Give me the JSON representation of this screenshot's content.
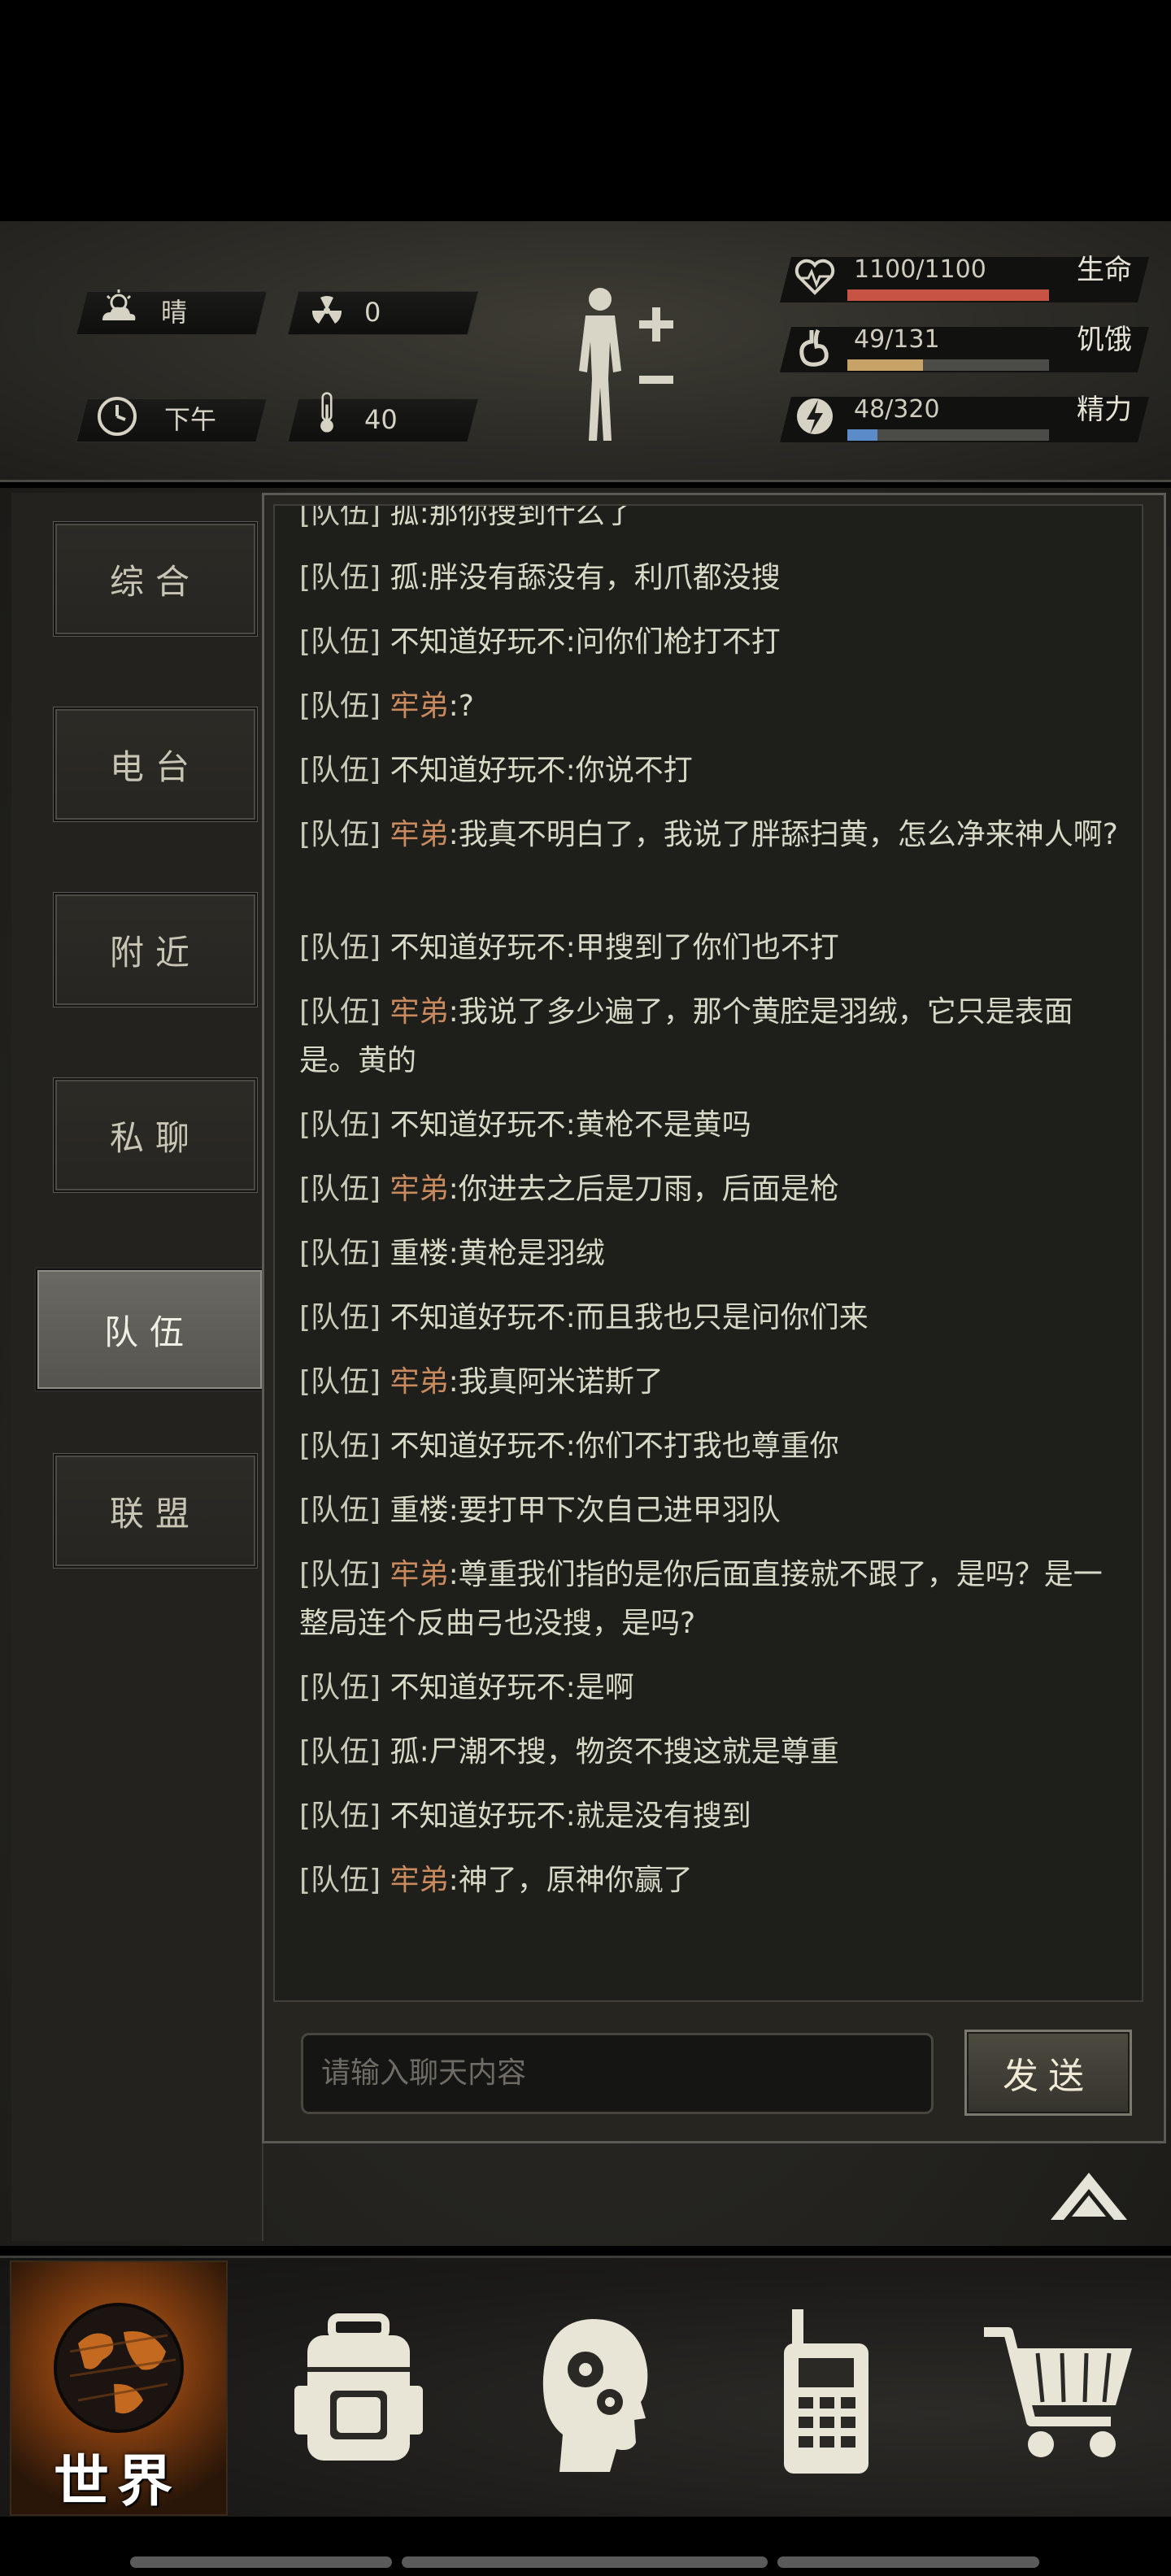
{
  "status": {
    "weather": {
      "icon": "partly-cloudy-icon",
      "label": "晴"
    },
    "radiation": {
      "icon": "radiation-icon",
      "value": "0"
    },
    "time_of_day": {
      "icon": "clock-icon",
      "label": "下午"
    },
    "temperature": {
      "icon": "thermometer-icon",
      "value": "40"
    },
    "body_status_icon": "body-figure-icon",
    "vitals": [
      {
        "name": "health",
        "icon": "heart-pulse-icon",
        "text": "1100/1100",
        "label": "生命",
        "fraction": 1.0,
        "color": "#c75344"
      },
      {
        "name": "hunger",
        "icon": "stomach-icon",
        "text": "49/131",
        "label": "饥饿",
        "fraction": 0.374,
        "color": "#c8a367"
      },
      {
        "name": "energy",
        "icon": "energy-bolt-icon",
        "text": "48/320",
        "label": "精力",
        "fraction": 0.15,
        "color": "#5b8cc9"
      }
    ]
  },
  "tabs": [
    {
      "label": "综合",
      "active": false
    },
    {
      "label": "电台",
      "active": false
    },
    {
      "label": "附近",
      "active": false
    },
    {
      "label": "私聊",
      "active": false
    },
    {
      "label": "队伍",
      "active": true
    },
    {
      "label": "联盟",
      "active": false
    }
  ],
  "chat": {
    "messages": [
      {
        "channel": "[队伍]",
        "sender": "孤",
        "text": ":那你搜到什么了",
        "highlight": false,
        "lines": 1
      },
      {
        "channel": "[队伍]",
        "sender": "孤",
        "text": ":胖没有舔没有，利爪都没搜",
        "highlight": false,
        "lines": 1
      },
      {
        "channel": "[队伍]",
        "sender": "不知道好玩不",
        "text": ":问你们枪打不打",
        "highlight": false,
        "lines": 1
      },
      {
        "channel": "[队伍]",
        "sender": "牢弟",
        "text": ":?",
        "highlight": true,
        "lines": 1
      },
      {
        "channel": "[队伍]",
        "sender": "不知道好玩不",
        "text": ":你说不打",
        "highlight": false,
        "lines": 1
      },
      {
        "channel": "[队伍]",
        "sender": "牢弟",
        "text": ":我真不明白了，我说了胖舔扫黄，怎么净来神人啊?",
        "highlight": true,
        "lines": 2
      },
      {
        "channel": "[队伍]",
        "sender": "不知道好玩不",
        "text": ":甲搜到了你们也不打",
        "highlight": false,
        "lines": 1
      },
      {
        "channel": "[队伍]",
        "sender": "牢弟",
        "text": ":我说了多少遍了，那个黄腔是羽绒，它只是表面是。黄的",
        "highlight": true,
        "lines": 2
      },
      {
        "channel": "[队伍]",
        "sender": "不知道好玩不",
        "text": ":黄枪不是黄吗",
        "highlight": false,
        "lines": 1
      },
      {
        "channel": "[队伍]",
        "sender": "牢弟",
        "text": ":你进去之后是刀雨，后面是枪",
        "highlight": true,
        "lines": 1
      },
      {
        "channel": "[队伍]",
        "sender": "重楼",
        "text": ":黄枪是羽绒",
        "highlight": false,
        "lines": 1
      },
      {
        "channel": "[队伍]",
        "sender": "不知道好玩不",
        "text": ":而且我也只是问你们来",
        "highlight": false,
        "lines": 1
      },
      {
        "channel": "[队伍]",
        "sender": "牢弟",
        "text": ":我真阿米诺斯了",
        "highlight": true,
        "lines": 1
      },
      {
        "channel": "[队伍]",
        "sender": "不知道好玩不",
        "text": ":你们不打我也尊重你",
        "highlight": false,
        "lines": 1
      },
      {
        "channel": "[队伍]",
        "sender": "重楼",
        "text": ":要打甲下次自己进甲羽队",
        "highlight": false,
        "lines": 1
      },
      {
        "channel": "[队伍]",
        "sender": "牢弟",
        "text": ":尊重我们指的是你后面直接就不跟了，是吗？是一整局连个反曲弓也没搜，是吗?",
        "highlight": true,
        "lines": 2
      },
      {
        "channel": "[队伍]",
        "sender": "不知道好玩不",
        "text": ":是啊",
        "highlight": false,
        "lines": 1
      },
      {
        "channel": "[队伍]",
        "sender": "孤",
        "text": ":尸潮不搜，物资不搜这就是尊重",
        "highlight": false,
        "lines": 1
      },
      {
        "channel": "[队伍]",
        "sender": "不知道好玩不",
        "text": ":就是没有搜到",
        "highlight": false,
        "lines": 1
      },
      {
        "channel": "[队伍]",
        "sender": "牢弟",
        "text": ":神了，原神你赢了",
        "highlight": true,
        "lines": 1
      }
    ],
    "input_placeholder": "请输入聊天内容",
    "send_label": "发送"
  },
  "nav": {
    "items": [
      {
        "name": "world",
        "icon": "globe-icon",
        "label": "世界",
        "active": true
      },
      {
        "name": "backpack",
        "icon": "backpack-icon",
        "active": false
      },
      {
        "name": "skills",
        "icon": "head-gears-icon",
        "active": false
      },
      {
        "name": "radio",
        "icon": "walkie-talkie-icon",
        "active": false
      },
      {
        "name": "shop",
        "icon": "shopping-cart-icon",
        "active": false
      }
    ]
  },
  "colors": {
    "highlight_sender": "#c98a5e",
    "text": "#d7d9c6"
  }
}
